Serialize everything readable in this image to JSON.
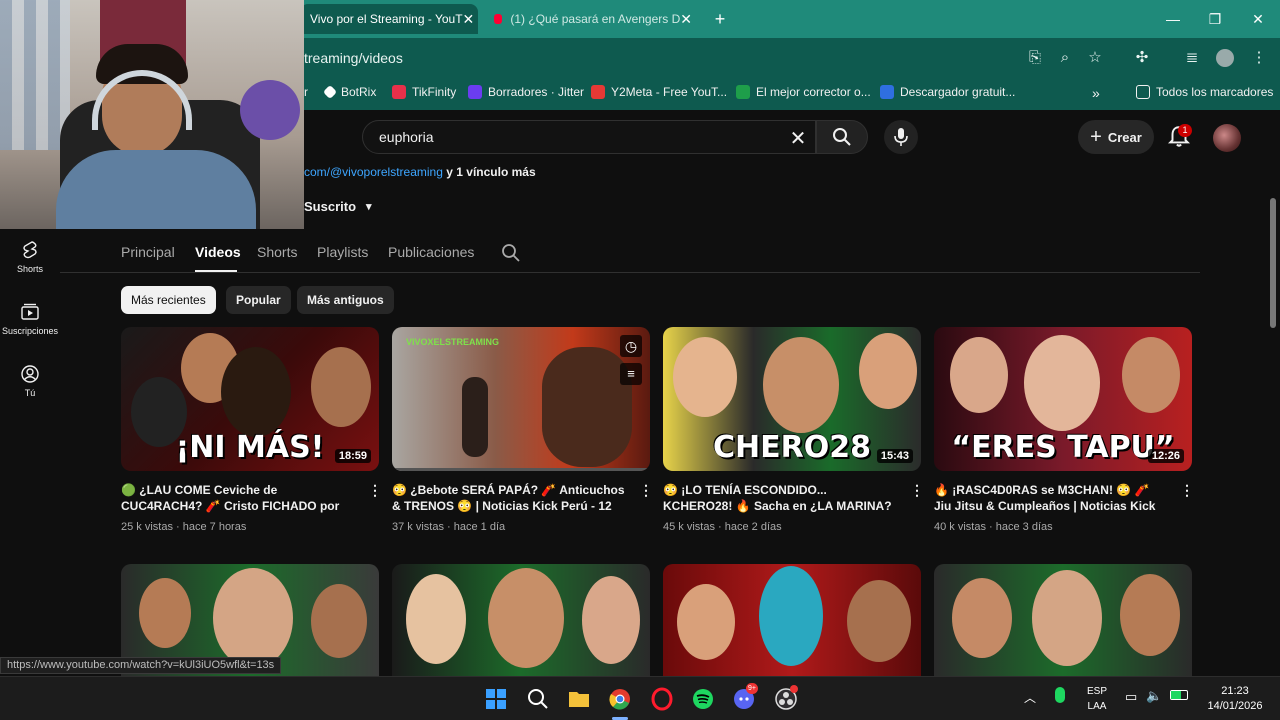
{
  "browser": {
    "tabs": [
      {
        "label": "Vivo por el Streaming - YouT",
        "active": true
      },
      {
        "label": "(1) ¿Qué pasará en Avengers D",
        "active": false
      }
    ],
    "new_tab": "+",
    "url": "treaming/videos",
    "bookmarks": [
      {
        "label": "r",
        "color": "#0e5a4f"
      },
      {
        "label": "BotRix",
        "color": "#ffffff"
      },
      {
        "label": "TikFinity",
        "color": "#e8304a"
      },
      {
        "label": "Borradores · Jitter",
        "color": "#6b3df0"
      },
      {
        "label": "Y2Meta - Free YouT...",
        "color": "#e53935"
      },
      {
        "label": "El mejor corrector o...",
        "color": "#1e9e4a"
      },
      {
        "label": "Descargador gratuit...",
        "color": "#2f6fe0"
      }
    ],
    "all_bookmarks": "Todos los marcadores"
  },
  "youtube": {
    "search_value": "euphoria",
    "create_label": "Crear",
    "notif_count": "1",
    "links_text": "com/@vivoporelstreaming",
    "links_more": "y 1 vínculo más",
    "subscribed_label": "Suscrito",
    "sidebar": [
      {
        "label": "Shorts"
      },
      {
        "label": "Suscripciones"
      },
      {
        "label": "Tú"
      }
    ],
    "tabs": [
      "Principal",
      "Videos",
      "Shorts",
      "Playlists",
      "Publicaciones"
    ],
    "chips": [
      "Más recientes",
      "Popular",
      "Más antiguos"
    ],
    "videos": [
      {
        "title": "🟢 ¿LAU COME Ceviche de CUC4RACH4? 🧨 Cristo FICHADO por NIKE 🔥 | Noticias...",
        "meta": "25 k vistas · hace 7 horas",
        "duration": "18:59",
        "overlay": "¡NI MÁS!"
      },
      {
        "title": "😳 ¿Bebote SERÁ PAPÁ? 🧨 Anticuchos & TRENOS 😳 | Noticias Kick Perú - 12 enero",
        "meta": "37 k vistas · hace 1 día",
        "duration": "",
        "overlay": ""
      },
      {
        "title": "😳 ¡LO TENÍA ESCONDIDO... KCHERO28! 🔥 Sacha en ¿LA MARINA? 😳 | Noticias Kick...",
        "meta": "45 k vistas · hace 2 días",
        "duration": "15:43",
        "overlay": "CHERO28"
      },
      {
        "title": "🔥 ¡RASC4D0RAS se M3CHAN! 😳 🧨 Jiu Jitsu & Cumpleaños | Noticias Kick Perú - 1...",
        "meta": "40 k vistas · hace 3 días",
        "duration": "12:26",
        "overlay": "“ERES TAPU”"
      }
    ],
    "thumb2_watermark": "VIVOXELSTREAMING"
  },
  "status_url": "https://www.youtube.com/watch?v=kUl3iUO5wfl&t=13s",
  "taskbar": {
    "lang_1": "ESP",
    "lang_2": "LAA",
    "time": "21:23",
    "date": "14/01/2026",
    "discord_badge": "9+"
  }
}
